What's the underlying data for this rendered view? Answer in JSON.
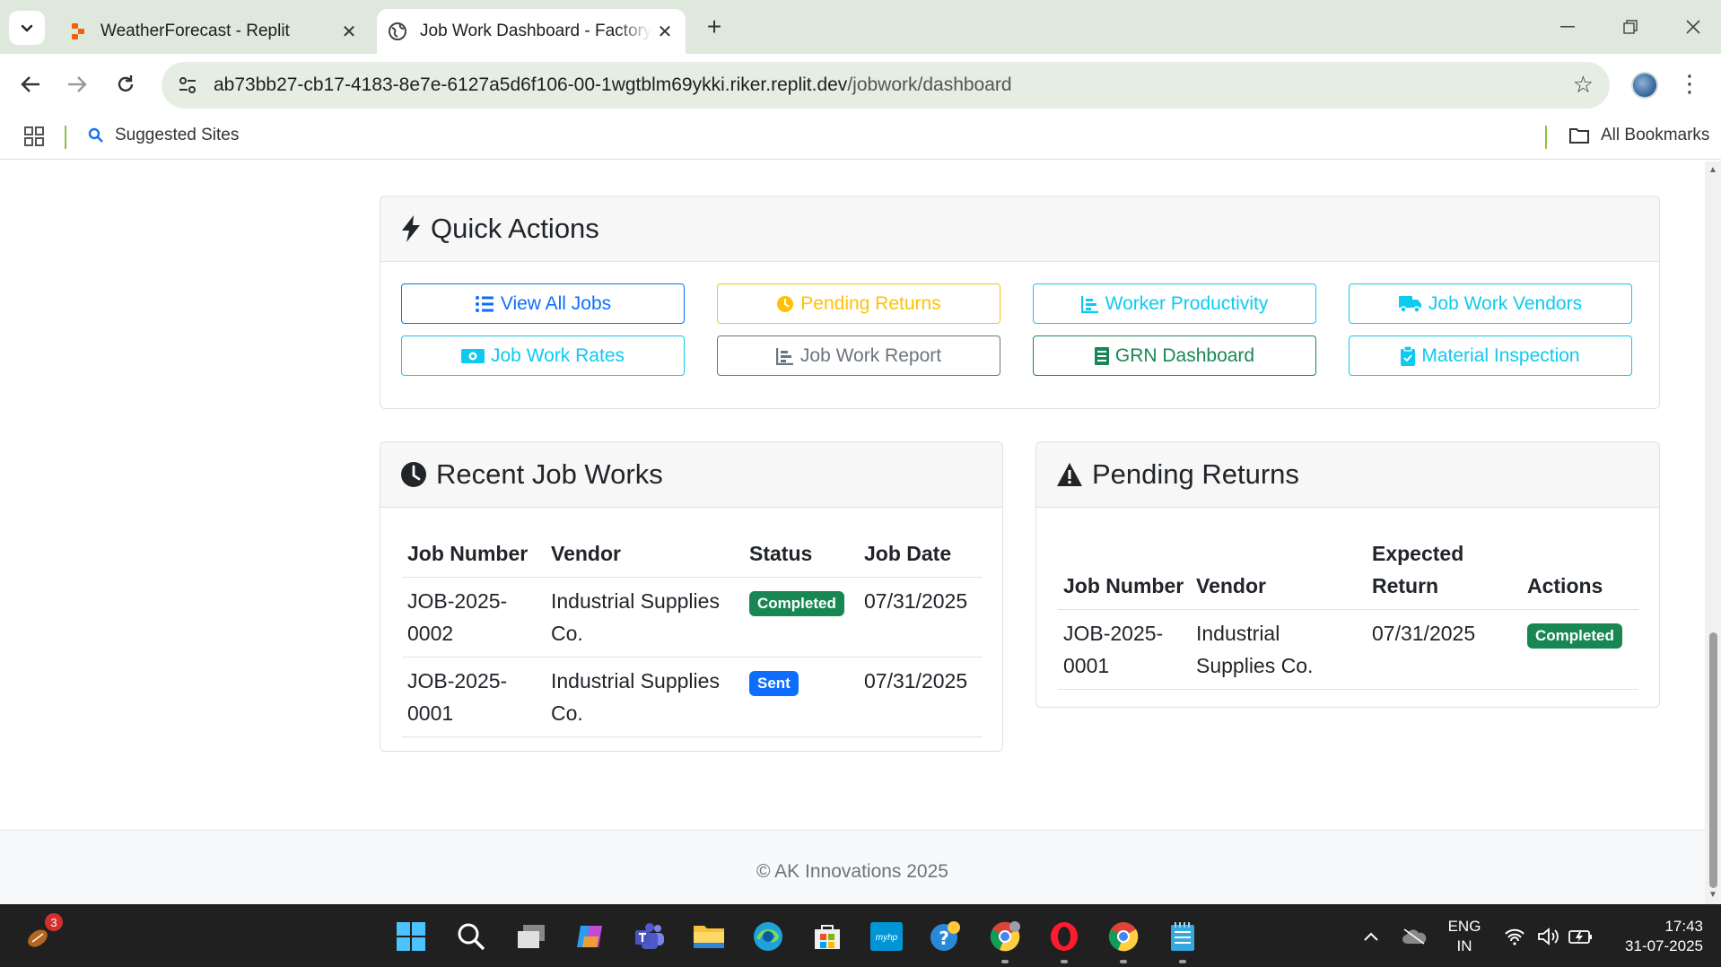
{
  "browser": {
    "tabs": [
      {
        "title": "WeatherForecast - Replit",
        "active": false
      },
      {
        "title": "Job Work Dashboard - Factory Management",
        "active": true
      }
    ],
    "url_host": "ab73bb27-cb17-4183-8e7e-6127a5d6f106-00-1wgtblm69ykki.riker.replit.dev",
    "url_path": "/jobwork/dashboard",
    "bookmarks": {
      "suggested_sites": "Suggested Sites",
      "all_bookmarks": "All Bookmarks"
    }
  },
  "quick_actions": {
    "title": "Quick Actions",
    "buttons": [
      {
        "label": "View All Jobs",
        "variant": "primary",
        "icon": "list-icon"
      },
      {
        "label": "Pending Returns",
        "variant": "warning",
        "icon": "clock-icon"
      },
      {
        "label": "Worker Productivity",
        "variant": "info",
        "icon": "chart-icon"
      },
      {
        "label": "Job Work Vendors",
        "variant": "info",
        "icon": "truck-icon"
      },
      {
        "label": "Job Work Rates",
        "variant": "info",
        "icon": "money-icon"
      },
      {
        "label": "Job Work Report",
        "variant": "secondary",
        "icon": "chart-icon"
      },
      {
        "label": "GRN Dashboard",
        "variant": "success",
        "icon": "document-icon"
      },
      {
        "label": "Material Inspection",
        "variant": "info",
        "icon": "clipboard-check-icon"
      }
    ]
  },
  "recent_job_works": {
    "title": "Recent Job Works",
    "columns": [
      "Job Number",
      "Vendor",
      "Status",
      "Job Date"
    ],
    "rows": [
      {
        "job_number": "JOB-2025-0002",
        "vendor": "Industrial Supplies Co.",
        "status": "Completed",
        "status_color": "#198754",
        "job_date": "07/31/2025"
      },
      {
        "job_number": "JOB-2025-0001",
        "vendor": "Industrial Supplies Co.",
        "status": "Sent",
        "status_color": "#0d6efd",
        "job_date": "07/31/2025"
      }
    ]
  },
  "pending_returns": {
    "title": "Pending Returns",
    "columns": [
      "Job Number",
      "Vendor",
      "Expected Return",
      "Actions"
    ],
    "rows": [
      {
        "job_number": "JOB-2025-0001",
        "vendor": "Industrial Supplies Co.",
        "expected_return": "07/31/2025",
        "action": "Completed"
      }
    ]
  },
  "footer": {
    "text": "© AK Innovations 2025"
  },
  "taskbar": {
    "notification_count": "3",
    "language": "ENG",
    "region": "IN",
    "time": "17:43",
    "date": "31-07-2025"
  },
  "colors": {
    "primary": "#0d6efd",
    "warning": "#ffc107",
    "info": "#0dcaf0",
    "secondary": "#6c757d",
    "success": "#198754"
  }
}
